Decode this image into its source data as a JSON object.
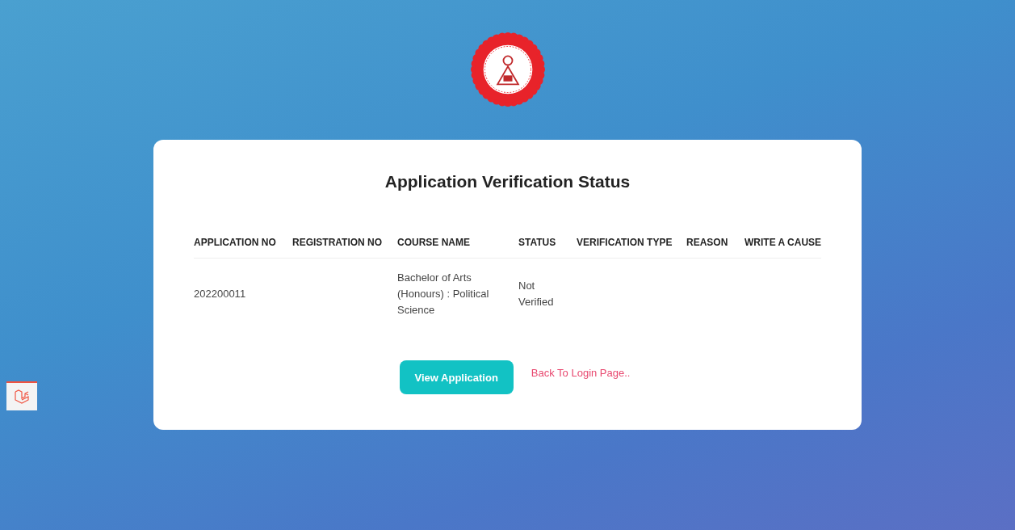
{
  "title": "Application Verification Status",
  "table": {
    "columns": [
      "APPLICATION NO",
      "REGISTRATION NO",
      "COURSE NAME",
      "STATUS",
      "VERIFICATION TYPE",
      "REASON",
      "WRITE A CAUSE"
    ],
    "rows": [
      [
        "202200011",
        "",
        "Bachelor of Arts (Honours) : Political Science",
        "Not Verified",
        "",
        "",
        ""
      ]
    ]
  },
  "actions": {
    "primary": "View Application",
    "link": "Back To Login Page.."
  }
}
